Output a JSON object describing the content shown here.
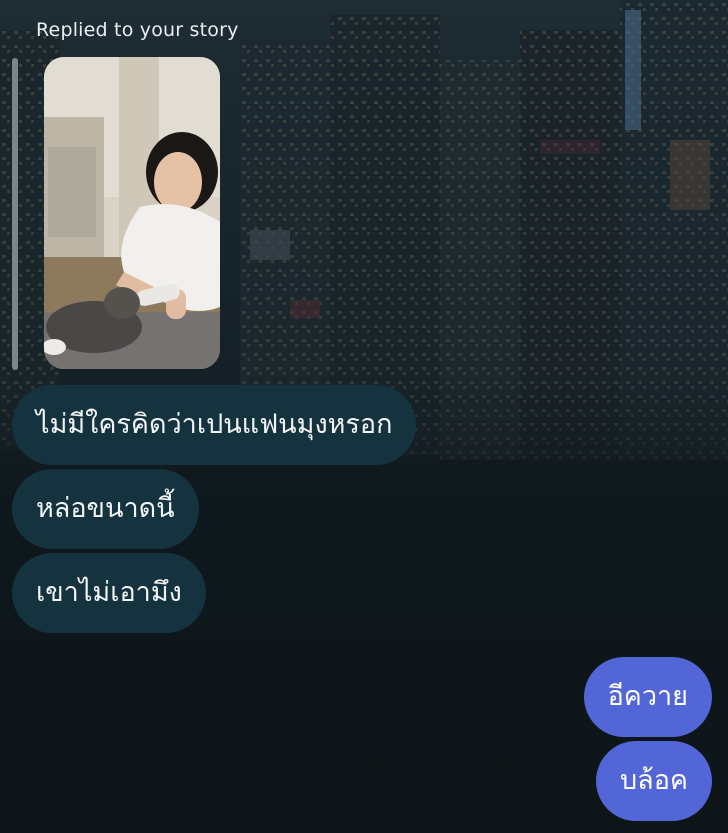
{
  "reply_header": {
    "caption": "Replied to your story"
  },
  "story_preview": {
    "description_icon": "story-photo-thumbnail"
  },
  "messages": [
    {
      "direction": "received",
      "text": "ไม่มีใครคิดว่าเปนแฟนมุงหรอก"
    },
    {
      "direction": "received",
      "text": "หล่อขนาดนี้"
    },
    {
      "direction": "received",
      "text": "เขาไม่เอามึง"
    },
    {
      "direction": "sent",
      "text": "อีควาย"
    },
    {
      "direction": "sent",
      "text": "บล้อค"
    }
  ],
  "colors": {
    "received_bubble": "#15323f",
    "sent_bubble": "#5366d8",
    "background": "#10191d"
  }
}
